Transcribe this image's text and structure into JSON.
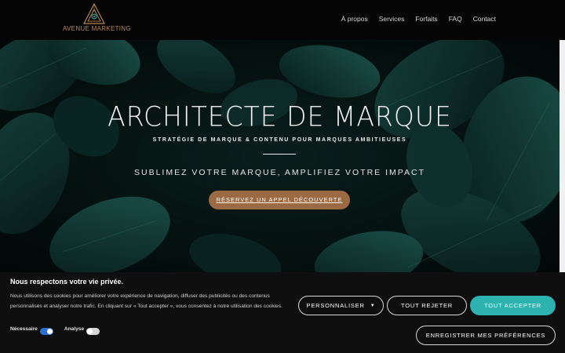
{
  "header": {
    "logo_text": "AVENUE MARKETING",
    "nav": [
      "À propos",
      "Services",
      "Forfaits",
      "FAQ",
      "Contact"
    ]
  },
  "hero": {
    "title": "ARCHITECTE DE MARQUE",
    "subtitle": "STRATÉGIE DE MARQUE & CONTENU POUR MARQUES AMBITIEUSES",
    "tagline": "SUBLIMEZ VOTRE MARQUE, AMPLIFIEZ VOTRE IMPACT",
    "cta": "RÉSERVEZ UN APPEL DÉCOUVERTE"
  },
  "cookie": {
    "title": "Nous respectons votre vie privée.",
    "text": "Nous utilisons des cookies pour améliorer votre expérience de navigation, diffuser des publicités ou des contenus personnalisés et analyser notre trafic. En cliquant sur « Tout accepter », vous consentez à notre utilisation des cookies.",
    "toggles": [
      {
        "label": "Nécessaire",
        "on": true
      },
      {
        "label": "Analyse",
        "on": false
      }
    ],
    "buttons": {
      "customize": "PERSONNALISER",
      "reject": "TOUT REJETER",
      "accept": "TOUT ACCEPTER",
      "save": "ENREGISTRER MES PRÉFÉRENCES"
    }
  },
  "colors": {
    "accent_teal": "#2cb3b0",
    "cta_brown": "#9b6a43",
    "logo_gold": "#b8864e",
    "toggle_on": "#2a6fd6"
  }
}
